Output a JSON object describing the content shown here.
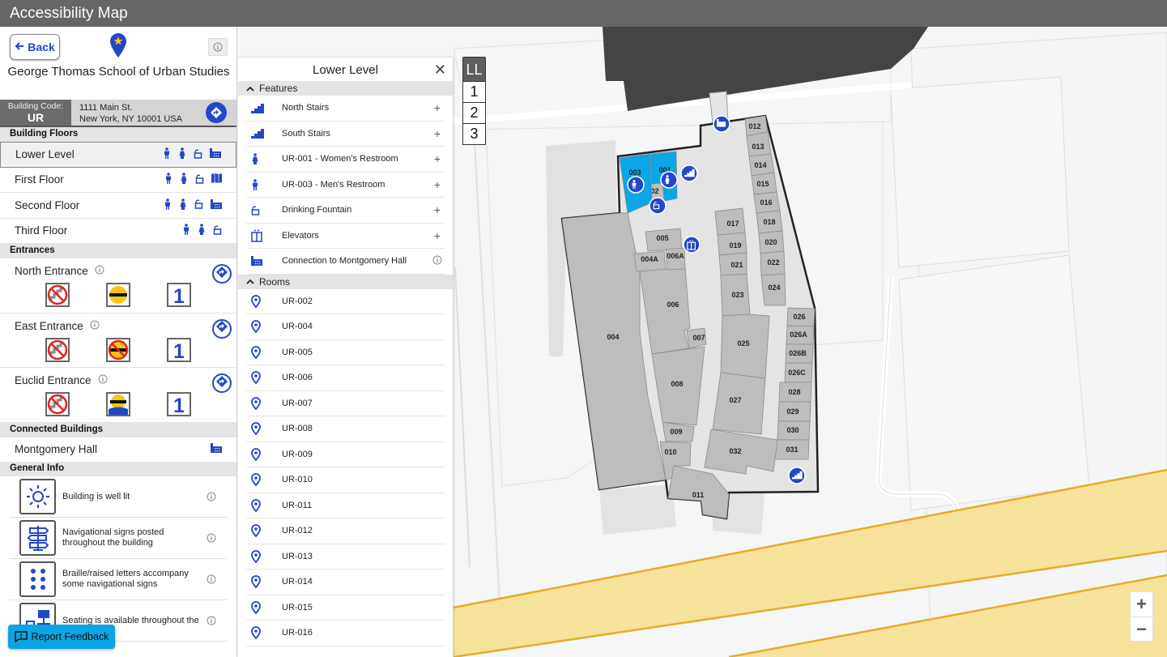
{
  "app": {
    "title": "Accessibility Map"
  },
  "sidebar": {
    "back_label": "Back",
    "building_name": "George Thomas School of Urban Studies",
    "building_code_label": "Building Code:",
    "building_code": "UR",
    "address_line1": "1111 Main St.",
    "address_line2": "New York, NY 10001 USA",
    "floors_header": "Building Floors",
    "floors": [
      {
        "label": "Lower Level",
        "selected": true,
        "icons": [
          "mens-restroom",
          "womens-restroom",
          "drinking-fountain",
          "building-connection"
        ]
      },
      {
        "label": "First Floor",
        "selected": false,
        "icons": [
          "mens-restroom",
          "womens-restroom",
          "drinking-fountain",
          "map-book"
        ]
      },
      {
        "label": "Second Floor",
        "selected": false,
        "icons": [
          "mens-restroom",
          "womens-restroom",
          "drinking-fountain",
          "building-connection"
        ]
      },
      {
        "label": "Third Floor",
        "selected": false,
        "icons": [
          "mens-restroom",
          "womens-restroom",
          "drinking-fountain"
        ]
      }
    ],
    "entrances_header": "Entrances",
    "entrances": [
      {
        "label": "North Entrance",
        "badges": [
          "no-stairs",
          "automatic-door",
          "floor-1"
        ]
      },
      {
        "label": "East Entrance",
        "badges": [
          "no-stairs",
          "no-automatic-door",
          "floor-1"
        ]
      },
      {
        "label": "Euclid Entrance",
        "badges": [
          "no-stairs",
          "automatic-door-with-ramp",
          "floor-1"
        ]
      }
    ],
    "floor_badge_text": "1",
    "connected_header": "Connected Buildings",
    "connected": [
      {
        "label": "Montgomery Hall"
      }
    ],
    "general_header": "General Info",
    "general_info": [
      {
        "icon": "sun-icon",
        "text": "Building is well lit"
      },
      {
        "icon": "signpost-icon",
        "text": "Navigational signs posted throughout the building"
      },
      {
        "icon": "braille-icon",
        "text": "Braille/raised letters accompany some navigational signs"
      },
      {
        "icon": "seating-icon",
        "text": "Seating is available throughout the"
      }
    ],
    "report_label": "Report Feedback"
  },
  "panel": {
    "title": "Lower Level",
    "features_header": "Features",
    "features": [
      {
        "icon": "stairs",
        "label": "North Stairs",
        "action": "+"
      },
      {
        "icon": "stairs",
        "label": "South Stairs",
        "action": "+"
      },
      {
        "icon": "womens-restroom",
        "label": "UR-001 - Women's Restroom",
        "action": "+"
      },
      {
        "icon": "mens-restroom",
        "label": "UR-003 - Men's Restroom",
        "action": "+"
      },
      {
        "icon": "drinking-fountain",
        "label": "Drinking Fountain",
        "action": "+"
      },
      {
        "icon": "elevator",
        "label": "Elevators",
        "action": "+"
      },
      {
        "icon": "building-connection",
        "label": "Connection to Montgomery Hall",
        "action": "info"
      }
    ],
    "rooms_header": "Rooms",
    "rooms": [
      "UR-002",
      "UR-004",
      "UR-005",
      "UR-006",
      "UR-007",
      "UR-008",
      "UR-009",
      "UR-010",
      "UR-011",
      "UR-012",
      "UR-013",
      "UR-014",
      "UR-015",
      "UR-016"
    ]
  },
  "map": {
    "floor_switcher": [
      "LL",
      "1",
      "2",
      "3"
    ],
    "selected_floor": "LL",
    "zoom_in": "+",
    "zoom_out": "−",
    "rooms": [
      "001",
      "002",
      "003",
      "004",
      "004A",
      "005",
      "006",
      "006A",
      "007",
      "008",
      "009",
      "010",
      "011",
      "012",
      "013",
      "014",
      "015",
      "016",
      "017",
      "018",
      "019",
      "020",
      "021",
      "022",
      "023",
      "024",
      "025",
      "026",
      "026A",
      "026B",
      "026C",
      "027",
      "028",
      "029",
      "030",
      "031",
      "032"
    ]
  },
  "colors": {
    "accent": "#2347c9",
    "restroom_highlight": "#0aa6e6",
    "room_fill": "#bdbdbd",
    "corridor_fill": "#e4e4e4",
    "road": "#f6e29a",
    "road_edge": "#e3ad2a",
    "adjacent_building": "#444444",
    "topbar": "#666666",
    "report_button": "#0ba5e3"
  }
}
